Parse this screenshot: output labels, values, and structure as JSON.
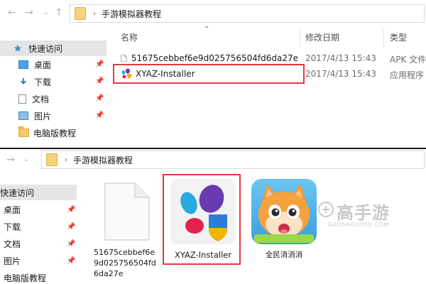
{
  "top": {
    "breadcrumb": [
      "手游模拟器教程"
    ],
    "sidebar": [
      {
        "label": "快速访问",
        "icon": "star-icon",
        "selected": true
      },
      {
        "label": "桌面",
        "icon": "desktop-icon",
        "pinned": true
      },
      {
        "label": "下载",
        "icon": "download-icon",
        "pinned": true
      },
      {
        "label": "文档",
        "icon": "document-icon",
        "pinned": true
      },
      {
        "label": "图片",
        "icon": "picture-icon",
        "pinned": true
      },
      {
        "label": "电脑版教程",
        "icon": "folder-icon"
      }
    ],
    "columns": {
      "name": "名称",
      "date": "修改日期",
      "type": "类型"
    },
    "files": [
      {
        "name": "51675cebbef6e9d025756504fd6da27e",
        "date": "2017/4/13 15:43",
        "type": "APK 文件",
        "icon": "file-icon"
      },
      {
        "name": "XYAZ-Installer",
        "date": "2017/4/13 15:43",
        "type": "应用程序",
        "icon": "xyaz-app-icon"
      }
    ]
  },
  "bottom": {
    "breadcrumb": [
      "手游模拟器教程"
    ],
    "sidebar": [
      {
        "label": "快速访问",
        "selected": true
      },
      {
        "label": "桌面",
        "pinned": true
      },
      {
        "label": "下载",
        "pinned": true
      },
      {
        "label": "文档",
        "pinned": true
      },
      {
        "label": "图片",
        "pinned": true
      },
      {
        "label": "电脑版教程"
      }
    ],
    "tiles": [
      {
        "label": "51675cebbef6e9d025756504fd6da27e",
        "icon": "blank-file-icon"
      },
      {
        "label": "XYAZ-Installer",
        "icon": "xyaz-app-icon"
      },
      {
        "label": "全民消消消",
        "icon": "cat-game-icon"
      }
    ]
  },
  "watermark": {
    "brand": "高手游",
    "domain": "GAOSHOUYOU.COM"
  },
  "colors": {
    "highlight_box": "#e4393c",
    "selected_bg": "#e5e5e5",
    "folder": "#f5c86a"
  }
}
